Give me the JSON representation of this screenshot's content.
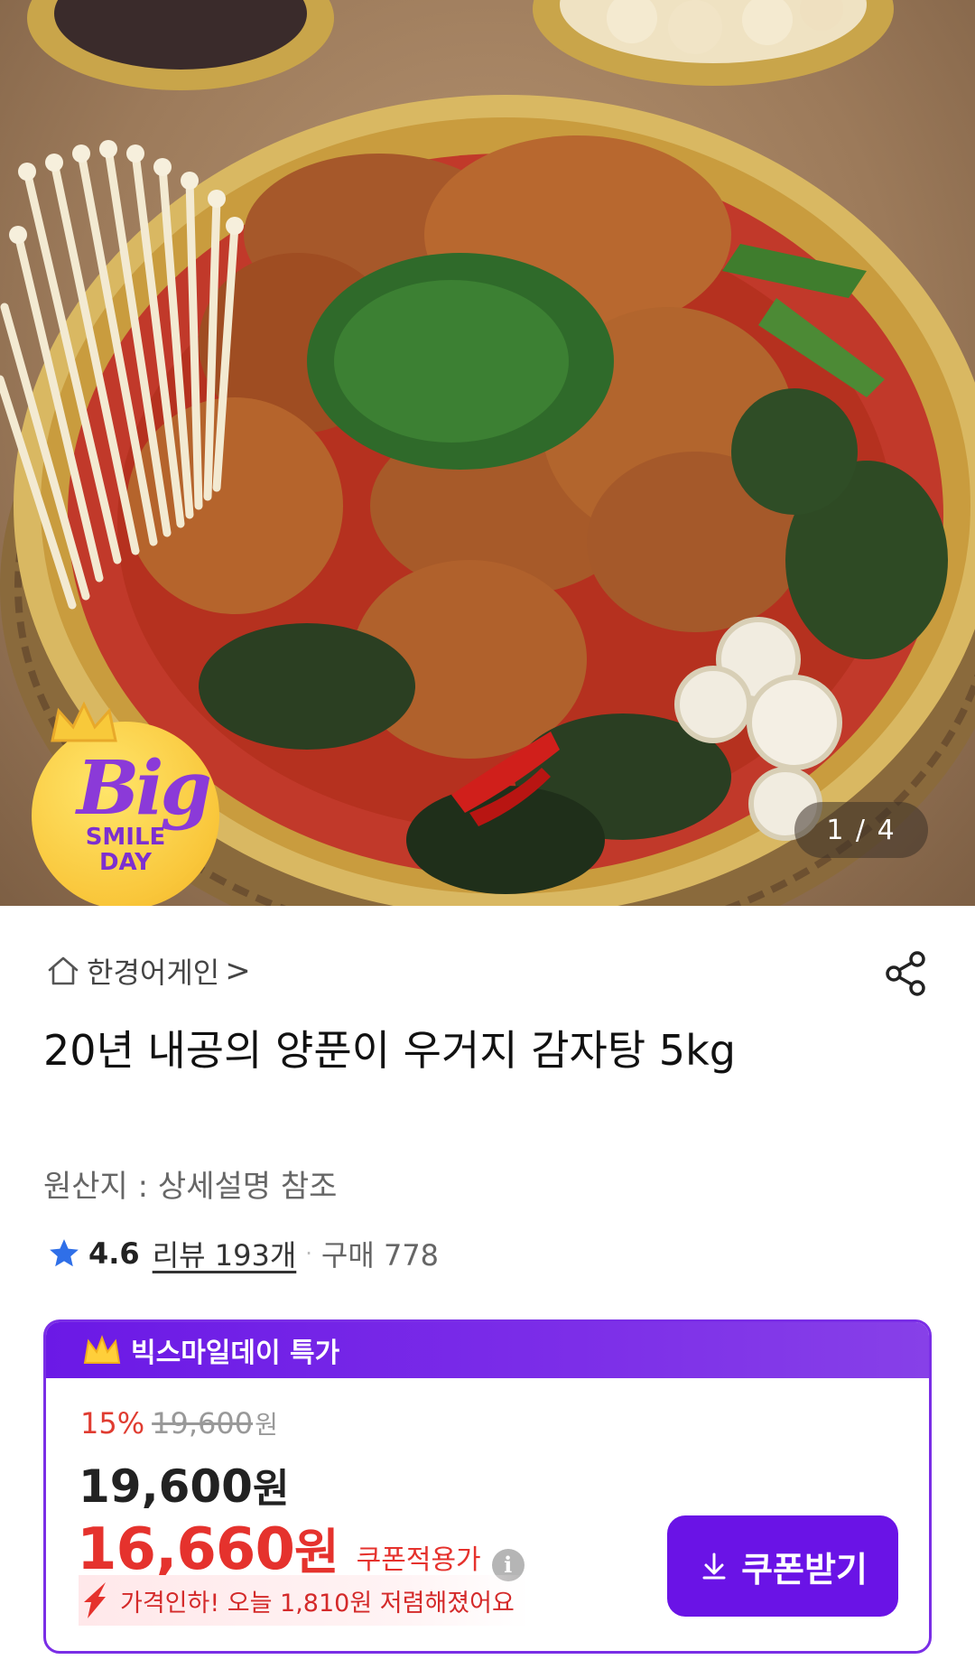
{
  "gallery": {
    "counter": "1 / 4",
    "badge_big": "Big",
    "badge_line1": "SMILE",
    "badge_line2": "DAY"
  },
  "store": {
    "name": "한경어게인",
    "chevron": ">"
  },
  "product": {
    "title": "20년 내공의 양푼이 우거지 감자탕 5kg",
    "origin": "원산지 : 상세설명 참조",
    "rating": "4.6",
    "reviews": "리뷰 193개",
    "separator": "·",
    "purchases": "구매 778"
  },
  "promo": {
    "title": "빅스마일데이 특가",
    "discount_rate": "15%",
    "original_price": "19,600",
    "original_won": "원",
    "price": "19,600",
    "price_won": "원",
    "coupon_price": "16,660",
    "coupon_won": "원",
    "coupon_label": "쿠폰적용가",
    "info_icon": "i",
    "price_drop_text": "가격인하! 오늘 1,810원 저렴해졌어요",
    "coupon_button": "쿠폰받기"
  },
  "colors": {
    "accent_purple": "#6a13e6",
    "discount_red": "#e5322d",
    "rating_star_blue": "#2f6fe8"
  },
  "icons": [
    "home-icon",
    "share-icon",
    "star-icon",
    "crown-icon",
    "info-icon",
    "price-drop-arrow-icon",
    "download-icon"
  ]
}
